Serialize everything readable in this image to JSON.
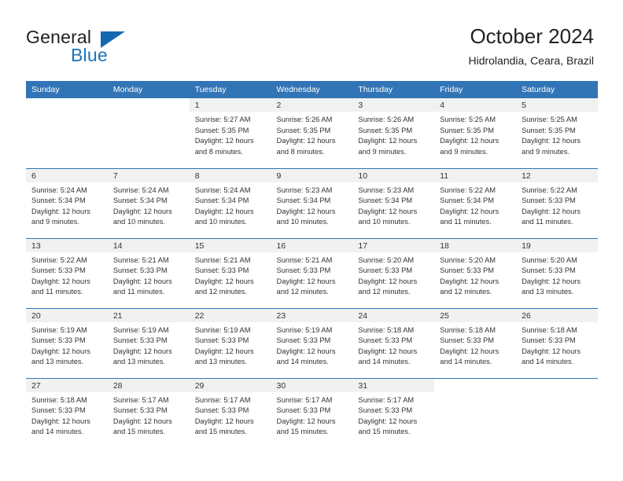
{
  "brand": {
    "name_dark": "General",
    "name_blue": "Blue",
    "accent_color": "#1b75bb",
    "header_blue": "#3275b6"
  },
  "header": {
    "title": "October 2024",
    "subtitle": "Hidrolandia, Ceara, Brazil"
  },
  "calendar": {
    "weekdays": [
      "Sunday",
      "Monday",
      "Tuesday",
      "Wednesday",
      "Thursday",
      "Friday",
      "Saturday"
    ],
    "weeks": [
      [
        {
          "date": "",
          "lines": []
        },
        {
          "date": "",
          "lines": []
        },
        {
          "date": "1",
          "lines": [
            "Sunrise: 5:27 AM",
            "Sunset: 5:35 PM",
            "Daylight: 12 hours",
            "and 8 minutes."
          ]
        },
        {
          "date": "2",
          "lines": [
            "Sunrise: 5:26 AM",
            "Sunset: 5:35 PM",
            "Daylight: 12 hours",
            "and 8 minutes."
          ]
        },
        {
          "date": "3",
          "lines": [
            "Sunrise: 5:26 AM",
            "Sunset: 5:35 PM",
            "Daylight: 12 hours",
            "and 9 minutes."
          ]
        },
        {
          "date": "4",
          "lines": [
            "Sunrise: 5:25 AM",
            "Sunset: 5:35 PM",
            "Daylight: 12 hours",
            "and 9 minutes."
          ]
        },
        {
          "date": "5",
          "lines": [
            "Sunrise: 5:25 AM",
            "Sunset: 5:35 PM",
            "Daylight: 12 hours",
            "and 9 minutes."
          ]
        }
      ],
      [
        {
          "date": "6",
          "lines": [
            "Sunrise: 5:24 AM",
            "Sunset: 5:34 PM",
            "Daylight: 12 hours",
            "and 9 minutes."
          ]
        },
        {
          "date": "7",
          "lines": [
            "Sunrise: 5:24 AM",
            "Sunset: 5:34 PM",
            "Daylight: 12 hours",
            "and 10 minutes."
          ]
        },
        {
          "date": "8",
          "lines": [
            "Sunrise: 5:24 AM",
            "Sunset: 5:34 PM",
            "Daylight: 12 hours",
            "and 10 minutes."
          ]
        },
        {
          "date": "9",
          "lines": [
            "Sunrise: 5:23 AM",
            "Sunset: 5:34 PM",
            "Daylight: 12 hours",
            "and 10 minutes."
          ]
        },
        {
          "date": "10",
          "lines": [
            "Sunrise: 5:23 AM",
            "Sunset: 5:34 PM",
            "Daylight: 12 hours",
            "and 10 minutes."
          ]
        },
        {
          "date": "11",
          "lines": [
            "Sunrise: 5:22 AM",
            "Sunset: 5:34 PM",
            "Daylight: 12 hours",
            "and 11 minutes."
          ]
        },
        {
          "date": "12",
          "lines": [
            "Sunrise: 5:22 AM",
            "Sunset: 5:33 PM",
            "Daylight: 12 hours",
            "and 11 minutes."
          ]
        }
      ],
      [
        {
          "date": "13",
          "lines": [
            "Sunrise: 5:22 AM",
            "Sunset: 5:33 PM",
            "Daylight: 12 hours",
            "and 11 minutes."
          ]
        },
        {
          "date": "14",
          "lines": [
            "Sunrise: 5:21 AM",
            "Sunset: 5:33 PM",
            "Daylight: 12 hours",
            "and 11 minutes."
          ]
        },
        {
          "date": "15",
          "lines": [
            "Sunrise: 5:21 AM",
            "Sunset: 5:33 PM",
            "Daylight: 12 hours",
            "and 12 minutes."
          ]
        },
        {
          "date": "16",
          "lines": [
            "Sunrise: 5:21 AM",
            "Sunset: 5:33 PM",
            "Daylight: 12 hours",
            "and 12 minutes."
          ]
        },
        {
          "date": "17",
          "lines": [
            "Sunrise: 5:20 AM",
            "Sunset: 5:33 PM",
            "Daylight: 12 hours",
            "and 12 minutes."
          ]
        },
        {
          "date": "18",
          "lines": [
            "Sunrise: 5:20 AM",
            "Sunset: 5:33 PM",
            "Daylight: 12 hours",
            "and 12 minutes."
          ]
        },
        {
          "date": "19",
          "lines": [
            "Sunrise: 5:20 AM",
            "Sunset: 5:33 PM",
            "Daylight: 12 hours",
            "and 13 minutes."
          ]
        }
      ],
      [
        {
          "date": "20",
          "lines": [
            "Sunrise: 5:19 AM",
            "Sunset: 5:33 PM",
            "Daylight: 12 hours",
            "and 13 minutes."
          ]
        },
        {
          "date": "21",
          "lines": [
            "Sunrise: 5:19 AM",
            "Sunset: 5:33 PM",
            "Daylight: 12 hours",
            "and 13 minutes."
          ]
        },
        {
          "date": "22",
          "lines": [
            "Sunrise: 5:19 AM",
            "Sunset: 5:33 PM",
            "Daylight: 12 hours",
            "and 13 minutes."
          ]
        },
        {
          "date": "23",
          "lines": [
            "Sunrise: 5:19 AM",
            "Sunset: 5:33 PM",
            "Daylight: 12 hours",
            "and 14 minutes."
          ]
        },
        {
          "date": "24",
          "lines": [
            "Sunrise: 5:18 AM",
            "Sunset: 5:33 PM",
            "Daylight: 12 hours",
            "and 14 minutes."
          ]
        },
        {
          "date": "25",
          "lines": [
            "Sunrise: 5:18 AM",
            "Sunset: 5:33 PM",
            "Daylight: 12 hours",
            "and 14 minutes."
          ]
        },
        {
          "date": "26",
          "lines": [
            "Sunrise: 5:18 AM",
            "Sunset: 5:33 PM",
            "Daylight: 12 hours",
            "and 14 minutes."
          ]
        }
      ],
      [
        {
          "date": "27",
          "lines": [
            "Sunrise: 5:18 AM",
            "Sunset: 5:33 PM",
            "Daylight: 12 hours",
            "and 14 minutes."
          ]
        },
        {
          "date": "28",
          "lines": [
            "Sunrise: 5:17 AM",
            "Sunset: 5:33 PM",
            "Daylight: 12 hours",
            "and 15 minutes."
          ]
        },
        {
          "date": "29",
          "lines": [
            "Sunrise: 5:17 AM",
            "Sunset: 5:33 PM",
            "Daylight: 12 hours",
            "and 15 minutes."
          ]
        },
        {
          "date": "30",
          "lines": [
            "Sunrise: 5:17 AM",
            "Sunset: 5:33 PM",
            "Daylight: 12 hours",
            "and 15 minutes."
          ]
        },
        {
          "date": "31",
          "lines": [
            "Sunrise: 5:17 AM",
            "Sunset: 5:33 PM",
            "Daylight: 12 hours",
            "and 15 minutes."
          ]
        },
        {
          "date": "",
          "lines": []
        },
        {
          "date": "",
          "lines": []
        }
      ]
    ]
  }
}
